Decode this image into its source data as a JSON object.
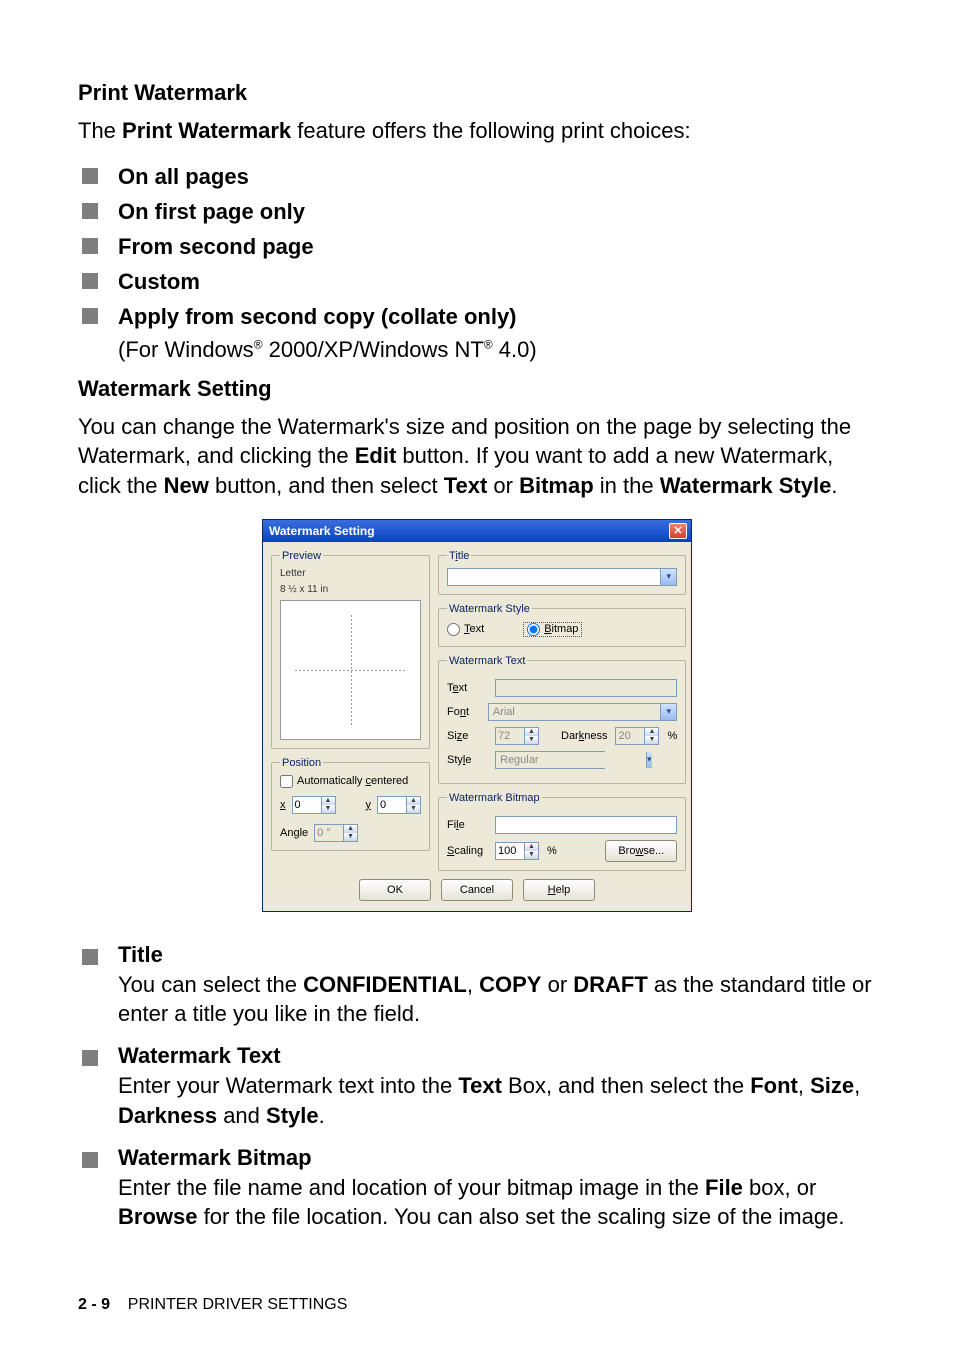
{
  "sections": {
    "printWatermark": {
      "heading": "Print Watermark",
      "intro_pre": "The ",
      "intro_bold": "Print Watermark",
      "intro_post": " feature offers the following print choices:",
      "bullets": [
        {
          "label": "On all pages"
        },
        {
          "label": "On first page only"
        },
        {
          "label": "From second page"
        },
        {
          "label": "Custom"
        },
        {
          "label": "Apply from second copy (collate only)",
          "sub_pre": "(For Windows",
          "sub_reg1": "®",
          "sub_mid": " 2000/XP/Windows NT",
          "sub_reg2": "®",
          "sub_post": " 4.0)"
        }
      ]
    },
    "watermarkSetting": {
      "heading": "Watermark Setting",
      "para": {
        "t1": "You can change the Watermark's size and position on the page by selecting the Watermark, and clicking the ",
        "b1": "Edit",
        "t2": " button. If you want to add a new Watermark, click the ",
        "b2": "New",
        "t3": " button, and then select ",
        "b3": "Text",
        "t4": " or ",
        "b4": "Bitmap",
        "t5": " in the ",
        "b5": "Watermark Style",
        "t6": "."
      }
    },
    "bottom": [
      {
        "head": "Title",
        "body": {
          "t1": "You can select the ",
          "b1": "CONFIDENTIAL",
          "t2": ", ",
          "b2": "COPY",
          "t3": " or ",
          "b3": "DRAFT",
          "t4": " as the standard title or enter a title you like in the field."
        }
      },
      {
        "head": "Watermark Text",
        "body": {
          "t1": "Enter your Watermark text into the ",
          "b1": "Text",
          "t2": " Box, and then select the ",
          "b2": "Font",
          "t3": ", ",
          "b3": "Size",
          "t4": ", ",
          "b4": "Darkness",
          "t5": " and ",
          "b5": "Style",
          "t6": "."
        }
      },
      {
        "head": "Watermark Bitmap",
        "body": {
          "t1": "Enter the file name and location of your bitmap image in the ",
          "b1": "File",
          "t2": " box, or ",
          "b2": "Browse",
          "t3": " for the file location. You can also set the scaling size of the image."
        }
      }
    ]
  },
  "dialog": {
    "title": "Watermark Setting",
    "preview": {
      "legend": "Preview",
      "paper_name": "Letter",
      "paper_size": "8 ½ x 11 in"
    },
    "position": {
      "legend": "Position",
      "auto_label_pre": "Automatically ",
      "auto_label_u": "c",
      "auto_label_post": "entered",
      "auto_checked": false,
      "x_label": "x",
      "x_value": "0",
      "y_label": "y",
      "y_value": "0",
      "angle_label": "Angle",
      "angle_value": "0 °"
    },
    "titleGroup": {
      "legend_pre": "T",
      "legend_u": "i",
      "legend_post": "tle",
      "value": ""
    },
    "styleGroup": {
      "legend": "Watermark Style",
      "text_label_u": "T",
      "text_label_post": "ext",
      "bitmap_label_u": "B",
      "bitmap_label_post": "itmap",
      "selected": "bitmap"
    },
    "textGroup": {
      "legend": "Watermark Text",
      "text_label_pre": "T",
      "text_label_u": "e",
      "text_label_post": "xt",
      "text_value": "",
      "font_label_pre": "Fo",
      "font_label_u": "n",
      "font_label_post": "t",
      "font_value": "Arial",
      "size_label_pre": "Si",
      "size_label_u": "z",
      "size_label_post": "e",
      "size_value": "72",
      "darkness_label_pre": "Dar",
      "darkness_label_u": "k",
      "darkness_label_post": "ness",
      "darkness_value": "20",
      "pct": "%",
      "style_label_pre": "Sty",
      "style_label_u": "l",
      "style_label_post": "e",
      "style_value": "Regular"
    },
    "bitmapGroup": {
      "legend": "Watermark Bitmap",
      "file_label_pre": "Fi",
      "file_label_u": "l",
      "file_label_post": "e",
      "file_value": "",
      "scaling_label_u": "S",
      "scaling_label_post": "caling",
      "scaling_value": "100",
      "pct": "%",
      "browse_pre": "Bro",
      "browse_u": "w",
      "browse_post": "se..."
    },
    "buttons": {
      "ok": "OK",
      "cancel": "Cancel",
      "help_u": "H",
      "help_post": "elp"
    }
  },
  "footer": {
    "page": "2 - 9",
    "section": "PRINTER DRIVER SETTINGS"
  }
}
